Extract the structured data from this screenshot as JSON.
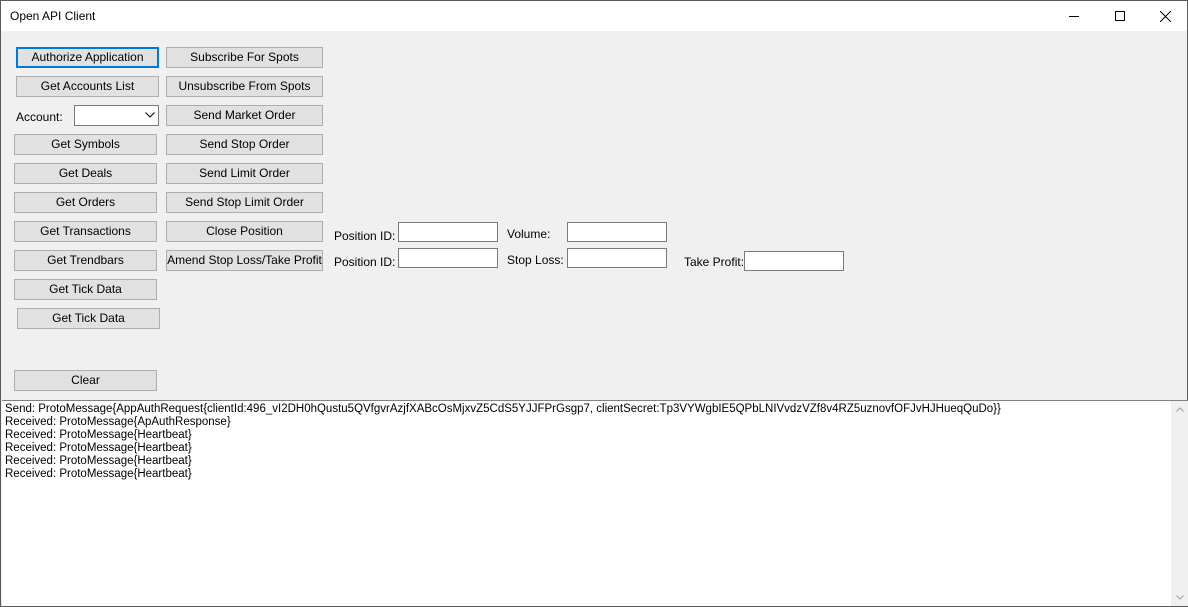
{
  "window": {
    "title": "Open API Client"
  },
  "buttons": {
    "authorize": "Authorize Application",
    "get_accounts": "Get Accounts List",
    "get_symbols": "Get Symbols",
    "get_deals": "Get Deals",
    "get_orders": "Get Orders",
    "get_transactions": "Get Transactions",
    "get_trendbars": "Get Trendbars",
    "get_tick_data": "Get Tick Data",
    "get_tick_data_2": "Get Tick Data",
    "clear": "Clear",
    "subscribe_spots": "Subscribe For Spots",
    "unsubscribe_spots": "Unsubscribe From Spots",
    "send_market_order": "Send Market Order",
    "send_stop_order": "Send Stop Order",
    "send_limit_order": "Send Limit Order",
    "send_stop_limit_order": "Send Stop Limit Order",
    "close_position": "Close Position",
    "amend_sl_tp": "Amend Stop Loss/Take Profit"
  },
  "account": {
    "label": "Account:",
    "value": ""
  },
  "close_position_form": {
    "position_id_label": "Position ID:",
    "position_id_value": "",
    "volume_label": "Volume:",
    "volume_value": ""
  },
  "amend_form": {
    "position_id_label": "Position ID:",
    "position_id_value": "",
    "stop_loss_label": "Stop Loss:",
    "stop_loss_value": "",
    "take_profit_label": "Take Profit:",
    "take_profit_value": ""
  },
  "log": [
    "Send: ProtoMessage{AppAuthRequest{clientId:496_vI2DH0hQustu5QVfgvrAzjfXABcOsMjxvZ5CdS5YJJFPrGsgp7, clientSecret:Tp3VYWgbIE5QPbLNIVvdzVZf8v4RZ5uznovfOFJvHJHueqQuDo}}",
    "Received: ProtoMessage{ApAuthResponse}",
    "Received: ProtoMessage{Heartbeat}",
    "Received: ProtoMessage{Heartbeat}",
    "Received: ProtoMessage{Heartbeat}",
    "Received: ProtoMessage{Heartbeat}"
  ]
}
